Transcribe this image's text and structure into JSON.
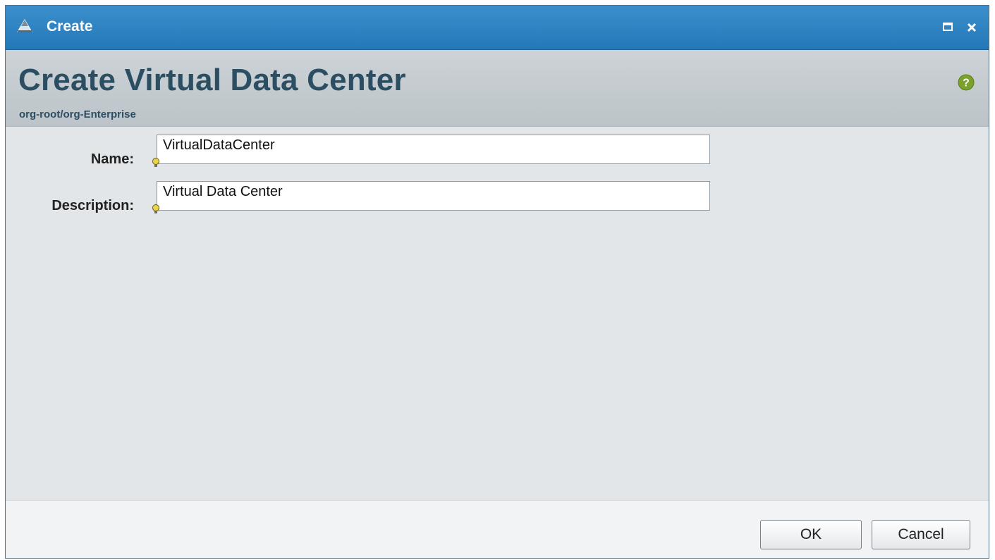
{
  "window": {
    "title": "Create",
    "icons": {
      "app": "pyramid-icon",
      "maximize": "maximize-icon",
      "close": "close-icon",
      "help": "help-icon",
      "hint": "lightbulb-icon"
    }
  },
  "header": {
    "title": "Create Virtual Data Center",
    "path": "org-root/org-Enterprise"
  },
  "form": {
    "name_label": "Name:",
    "name_value": "VirtualDataCenter",
    "description_label": "Description:",
    "description_value": "Virtual Data Center"
  },
  "footer": {
    "ok_label": "OK",
    "cancel_label": "Cancel"
  },
  "colors": {
    "titlebar": "#2f84c3",
    "header_text": "#2c4e62",
    "help": "#7aa22a"
  }
}
